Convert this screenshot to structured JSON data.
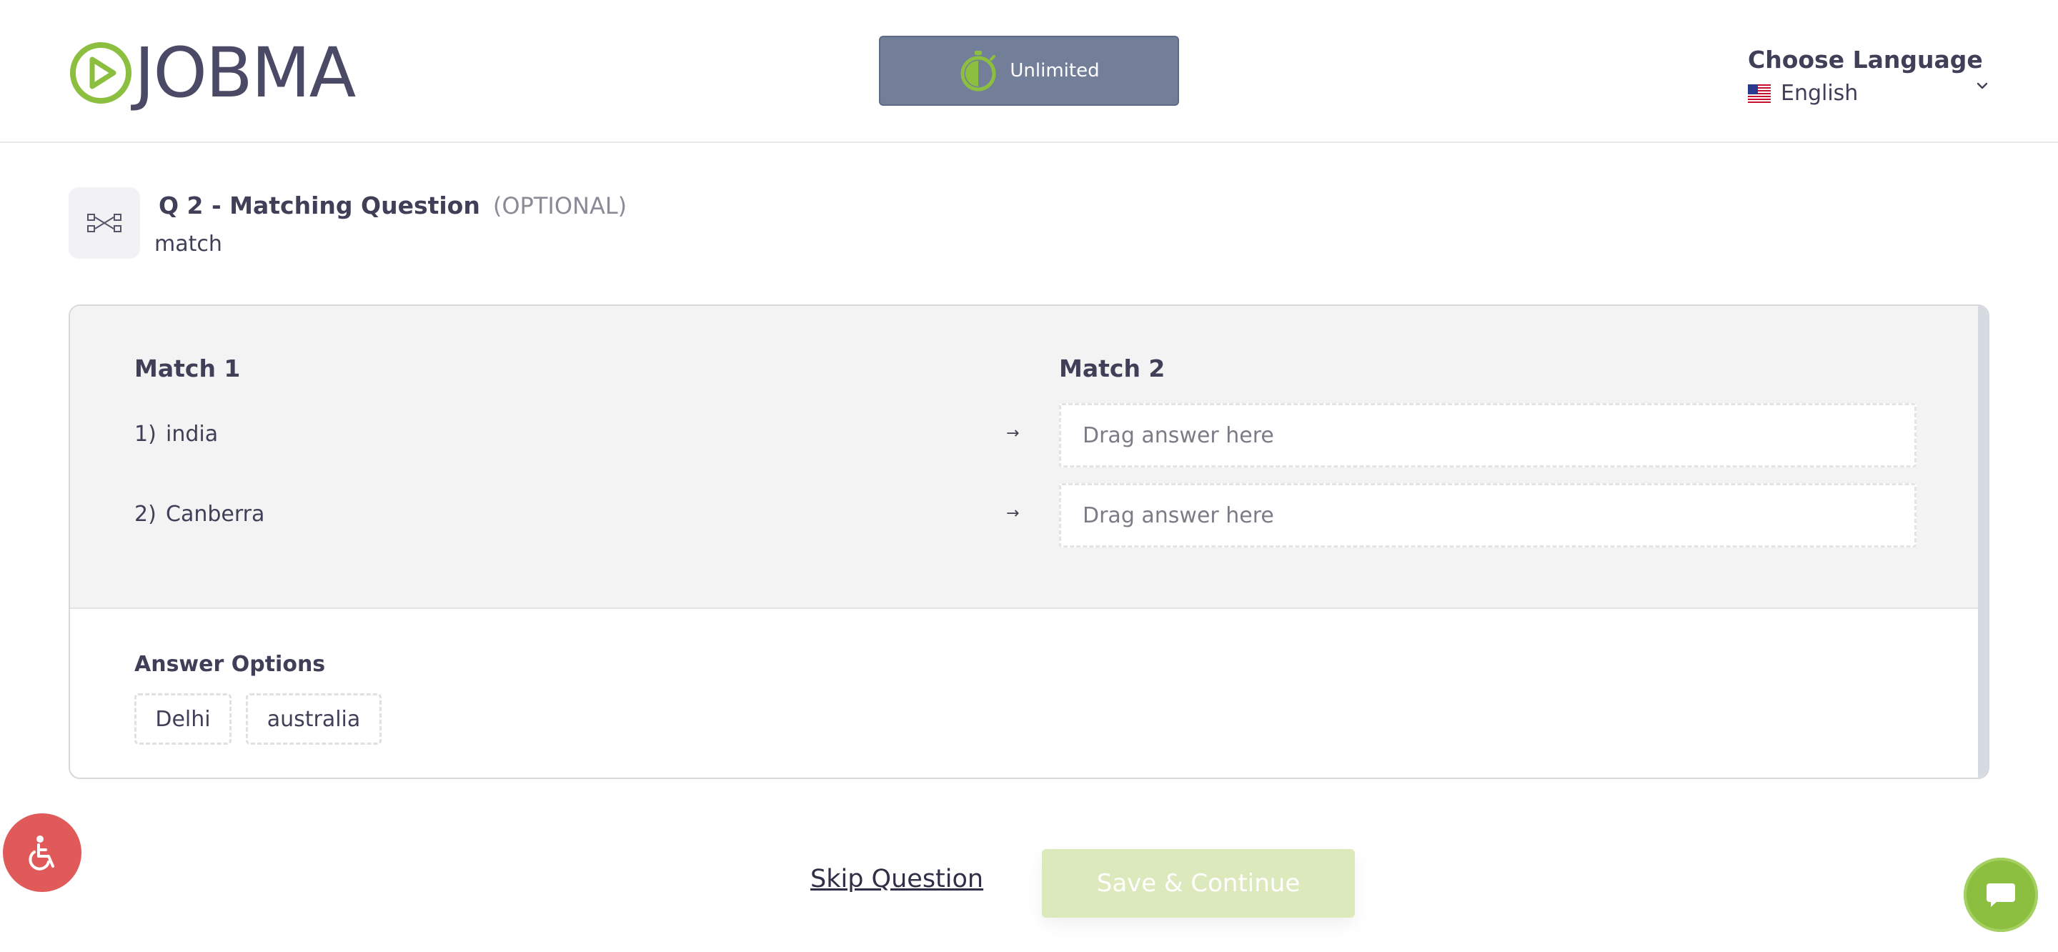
{
  "header": {
    "logo_text": "JOBMA",
    "timer_label": "Unlimited",
    "language": {
      "title": "Choose Language",
      "selected": "English"
    }
  },
  "question": {
    "title": "Q 2 - Matching Question",
    "optional_tag": "(OPTIONAL)",
    "subtitle": "match"
  },
  "matching": {
    "col1_header": "Match 1",
    "col2_header": "Match 2",
    "rows": [
      {
        "number": "1)",
        "prompt": "india",
        "placeholder": "Drag answer here"
      },
      {
        "number": "2)",
        "prompt": "Canberra",
        "placeholder": "Drag answer here"
      }
    ]
  },
  "answer_options": {
    "title": "Answer Options",
    "items": [
      "Delhi",
      "australia"
    ]
  },
  "actions": {
    "skip_label": "Skip Question",
    "save_label": "Save & Continue"
  },
  "colors": {
    "brand_green": "#8cbf3f",
    "timer_bg": "#737f99",
    "save_disabled": "#dce9bd",
    "accessibility_red": "#e05a5a",
    "text_dark": "#3f3f58"
  },
  "icons": {
    "logo": "play-circle-icon",
    "timer": "stopwatch-icon",
    "flag": "us-flag-icon",
    "dropdown": "chevron-down-icon",
    "question_type": "matching-icon",
    "arrow": "arrow-right-icon",
    "accessibility": "wheelchair-icon",
    "chat": "chat-bubble-icon"
  }
}
